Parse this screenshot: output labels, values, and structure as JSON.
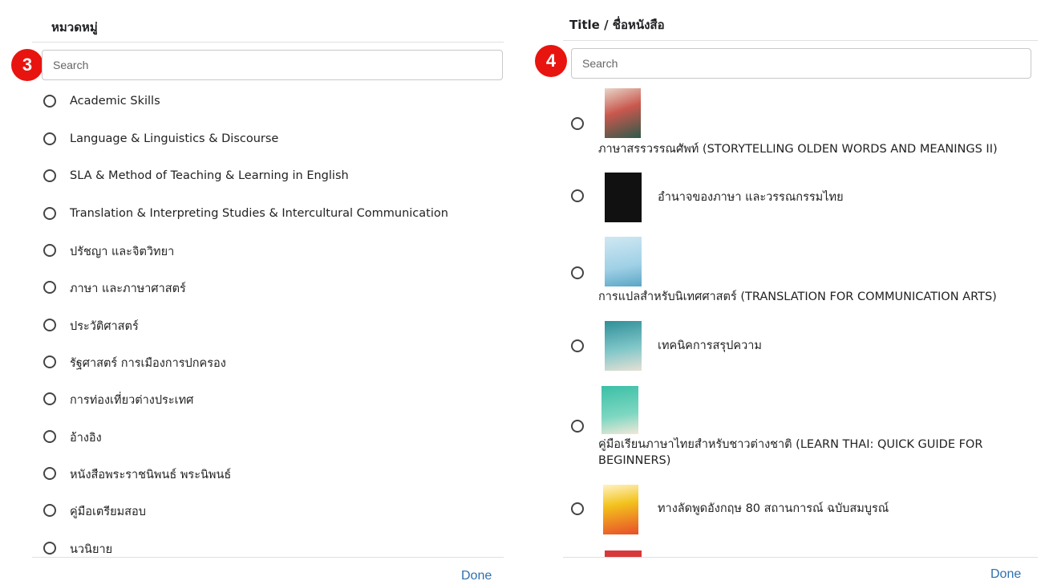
{
  "categories_panel": {
    "title": "หมวดหมู่",
    "step_number": "3",
    "search_placeholder": "Search",
    "items": [
      "Academic Skills",
      "Language & Linguistics & Discourse",
      "SLA & Method of Teaching & Learning in English",
      "Translation & Interpreting Studies & Intercultural Communication",
      "ปรัชญา และจิตวิทยา",
      "ภาษา และภาษาศาสตร์",
      "ประวัติศาสตร์",
      "รัฐศาสตร์ การเมืองการปกครอง",
      "การท่องเที่ยวต่างประเทศ",
      "อ้างอิง",
      "หนังสือพระราชนิพนธ์ พระนิพนธ์",
      "คู่มือเตรียมสอบ",
      "นวนิยาย"
    ],
    "done_label": "Done"
  },
  "titles_panel": {
    "title": "Title / ชื่อหนังสือ",
    "step_number": "4",
    "search_placeholder": "Search",
    "books": [
      {
        "title": "ภาษาสรรวรรณศัพท์ (STORYTELLING OLDEN WORDS AND MEANINGS II)",
        "cover_color": "#c9584e"
      },
      {
        "title": "อำนาจของภาษา และวรรณกรรมไทย",
        "cover_color": "#111111"
      },
      {
        "title": "การแปลสำหรับนิเทศศาสตร์ (TRANSLATION FOR COMMUNICATION ARTS)",
        "cover_color": "#9fd0e6"
      },
      {
        "title": "เทคนิคการสรุปความ",
        "cover_color": "#2f8f99"
      },
      {
        "title": "คู่มือเรียนภาษาไทยสำหรับชาวต่างชาติ (LEARN THAI: QUICK GUIDE FOR BEGINNERS)",
        "cover_color": "#3bbfa7"
      },
      {
        "title": "ทางลัดพูดอังกฤษ 80 สถานการณ์ ฉบับสมบูรณ์",
        "cover_color": "#f3c21c"
      }
    ],
    "done_label": "Done"
  },
  "colors": {
    "accent_done": "#2f6fb0",
    "step_badge": "#e8140f"
  }
}
